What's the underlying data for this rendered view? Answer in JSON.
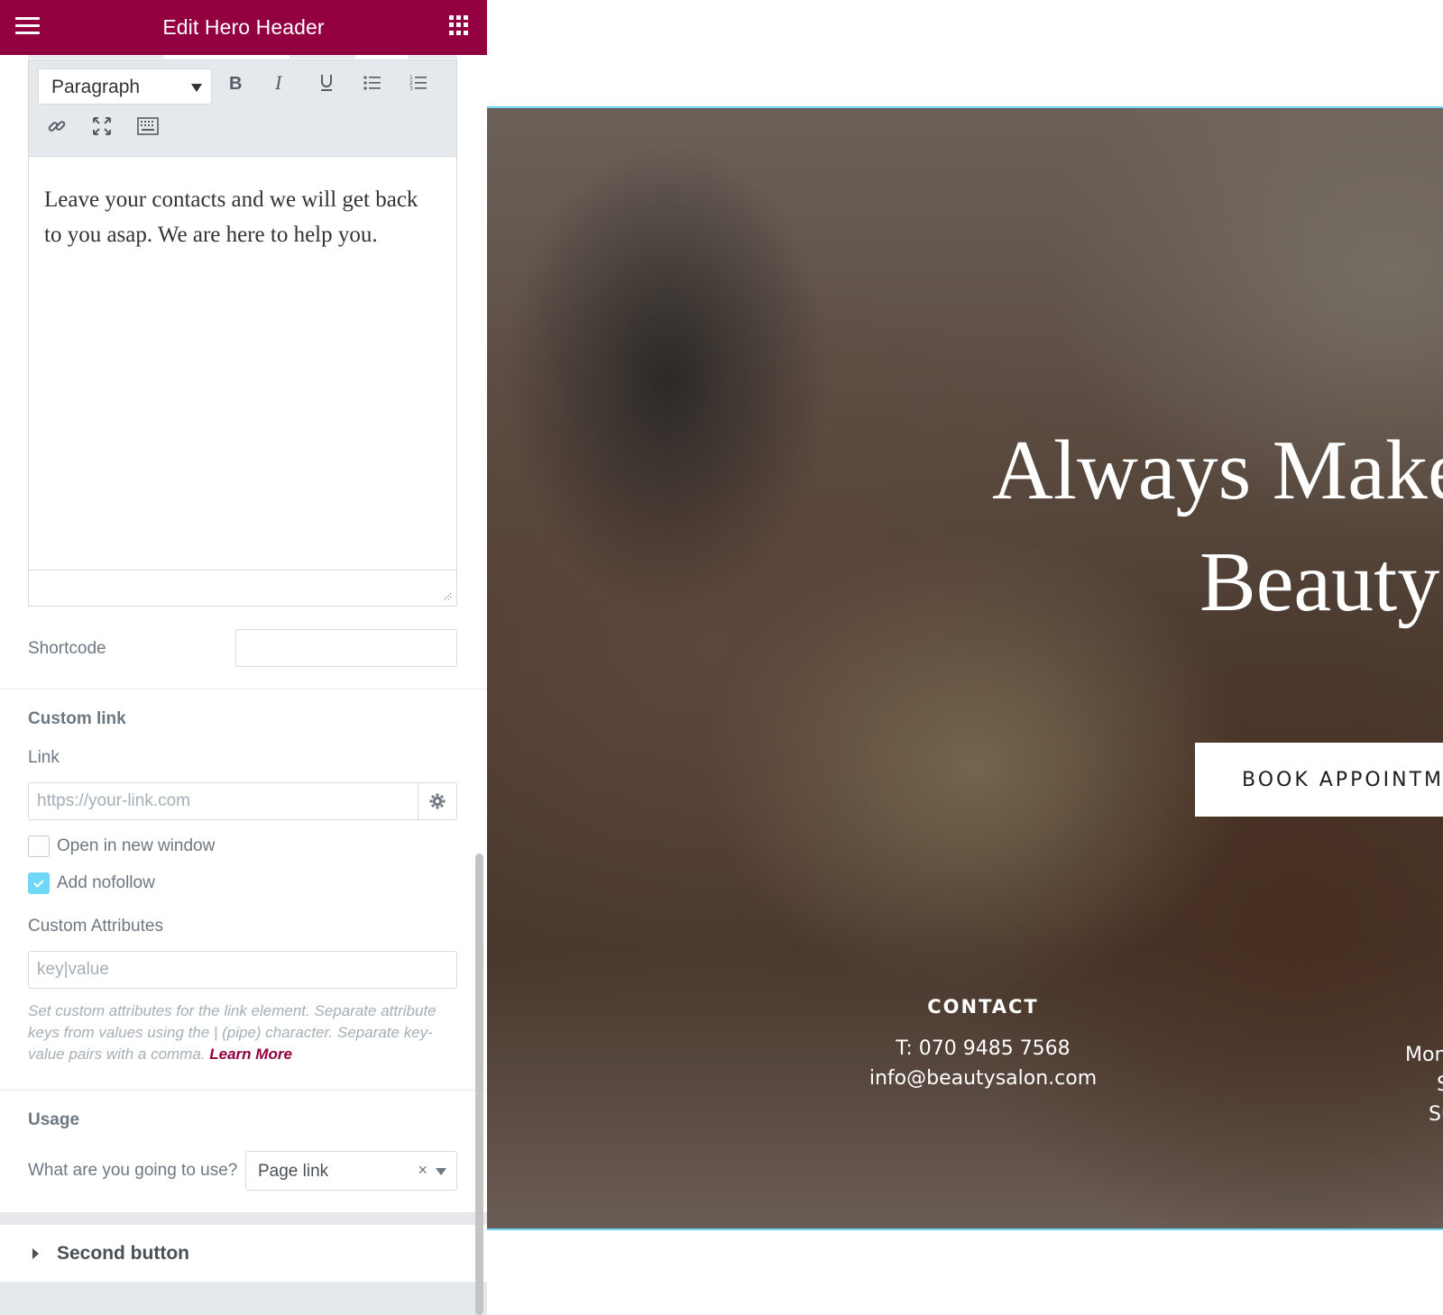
{
  "header": {
    "title": "Edit Hero Header"
  },
  "editor": {
    "format": "Paragraph",
    "content": "Leave your contacts and we will get back to you asap. We are here to help you."
  },
  "shortcode": {
    "label": "Shortcode",
    "value": ""
  },
  "custom_link": {
    "title": "Custom link",
    "link_label": "Link",
    "link_placeholder": "https://your-link.com",
    "open_new_window": {
      "label": "Open in new window",
      "checked": false
    },
    "nofollow": {
      "label": "Add nofollow",
      "checked": true
    },
    "attributes_label": "Custom Attributes",
    "attributes_placeholder": "key|value",
    "help_text": "Set custom attributes for the link element. Separate attribute keys from values using the | (pipe) character. Separate key-value pairs with a comma.",
    "learn_more": "Learn More"
  },
  "usage": {
    "title": "Usage",
    "question": "What are you going to use?",
    "selected": "Page link",
    "clear_glyph": "×"
  },
  "second_button": {
    "label": "Second button"
  },
  "colors": {
    "brand": "#93003f",
    "accent": "#71d7f7"
  },
  "preview": {
    "headline_line1": "Always Make",
    "headline_line2": "Beauty",
    "cta": "BOOK APPOINTME",
    "contact_heading": "CONTACT",
    "phone": "T: 070 9485 7568",
    "email": "info@beautysalon.com",
    "hours_fragments": [
      "Mon",
      "S",
      "Su"
    ]
  }
}
